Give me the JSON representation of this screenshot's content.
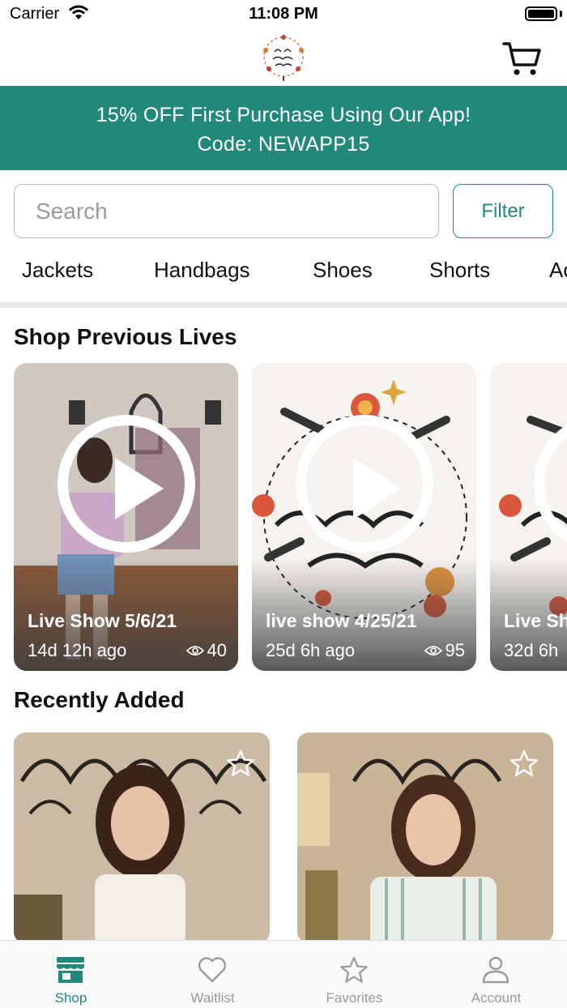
{
  "status_bar": {
    "carrier": "Carrier",
    "time": "11:08 PM"
  },
  "header": {
    "logo_icon": "boutique-logo-icon",
    "cart_icon": "cart-icon"
  },
  "promo": {
    "line1": "15% OFF First Purchase Using Our App!",
    "line2": "Code: NEWAPP15"
  },
  "search": {
    "placeholder": "Search",
    "filter_label": "Filter"
  },
  "categories": [
    "Jackets",
    "Handbags",
    "Shoes",
    "Shorts",
    "Ac"
  ],
  "previous_lives": {
    "title": "Shop Previous Lives",
    "items": [
      {
        "title": "Live Show 5/6/21",
        "ago": "14d 12h ago",
        "views": "40"
      },
      {
        "title": "live show 4/25/21",
        "ago": "25d 6h ago",
        "views": "95"
      },
      {
        "title": "Live Sh",
        "ago": "32d 6h",
        "views": ""
      }
    ]
  },
  "recently_added": {
    "title": "Recently Added"
  },
  "tabs": [
    {
      "label": "Shop",
      "icon": "store-icon",
      "active": true
    },
    {
      "label": "Waitlist",
      "icon": "heart-icon",
      "active": false
    },
    {
      "label": "Favorites",
      "icon": "star-icon",
      "active": false
    },
    {
      "label": "Account",
      "icon": "person-icon",
      "active": false
    }
  ],
  "colors": {
    "brand": "#22897a",
    "tab_inactive": "#999999",
    "promo_text": "#ffffff"
  }
}
